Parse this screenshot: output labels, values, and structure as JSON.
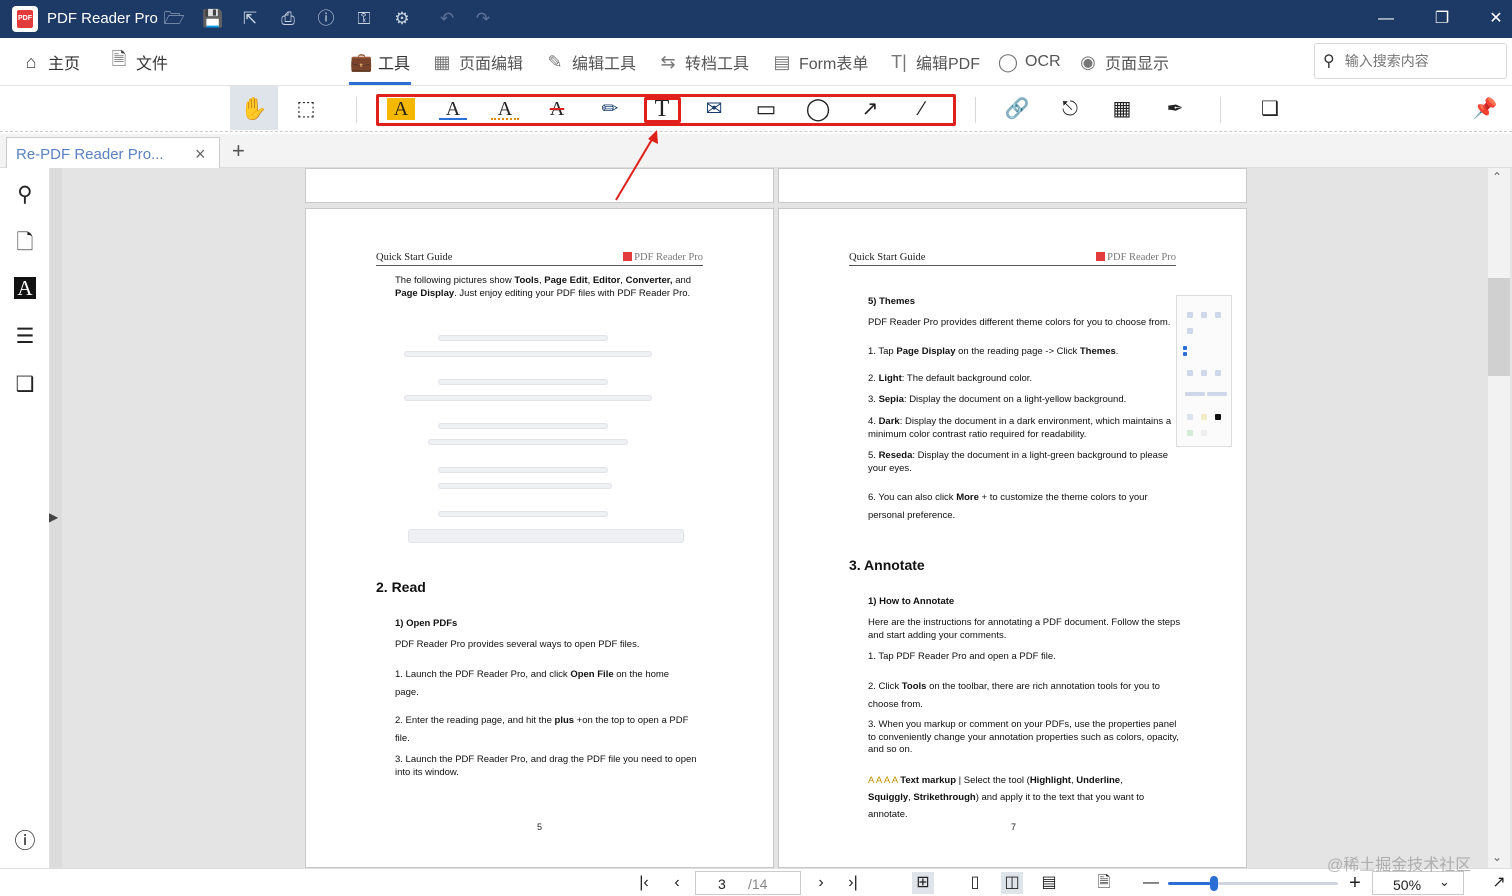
{
  "titlebar": {
    "app_title": "PDF Reader Pro",
    "logo_text": "PDF",
    "icons": [
      "open-folder-icon",
      "save-icon",
      "share-icon",
      "print-icon",
      "help-icon",
      "key-icon",
      "settings-icon",
      "undo-icon",
      "redo-icon"
    ],
    "window_buttons": [
      "minimize-icon",
      "restore-icon",
      "close-icon"
    ]
  },
  "menubar": {
    "home": "主页",
    "file": "文件",
    "tabs": [
      {
        "label": "工具",
        "icon": "toolbox-icon",
        "active": true
      },
      {
        "label": "页面编辑",
        "icon": "page-grid-icon"
      },
      {
        "label": "编辑工具",
        "icon": "edit-icon"
      },
      {
        "label": "转档工具",
        "icon": "convert-icon"
      },
      {
        "label": "Form表单",
        "icon": "form-icon"
      },
      {
        "label": "编辑PDF",
        "icon": "text-edit-icon"
      },
      {
        "label": "OCR",
        "icon": "ocr-icon"
      },
      {
        "label": "页面显示",
        "icon": "eye-icon"
      }
    ],
    "search_placeholder": "输入搜索内容"
  },
  "toolbar": {
    "tools": [
      "hand-icon",
      "area-select-icon",
      "highlight-icon",
      "underline-icon",
      "squiggly-icon",
      "strikethrough-icon",
      "freehand-icon",
      "text-box-icon",
      "note-icon",
      "rectangle-icon",
      "circle-icon",
      "arrow-icon",
      "line-icon",
      "link-icon",
      "stamp-icon",
      "image-icon",
      "signature-icon",
      "bookmark-icon",
      "pin-icon"
    ],
    "accent": "#e0201a"
  },
  "tab": {
    "label": "Re-PDF Reader Pro...",
    "close": "×",
    "add": "+"
  },
  "sidebar": [
    "search-icon",
    "thumbnail-icon",
    "annotation-list-icon",
    "outline-icon",
    "bookmark-icon",
    "info-icon"
  ],
  "page_left": {
    "header_left": "Quick Start Guide",
    "header_right": "PDF Reader Pro",
    "intro_1": "The following pictures show ",
    "intro_b1": "Tools",
    "intro_2": ", ",
    "intro_b2": "Page Edit",
    "intro_3": ", ",
    "intro_b3": "Editor",
    "intro_4": ", ",
    "intro_b4": "Converter,",
    "intro_5": " and",
    "intro_b5": "Page Display",
    "intro_6": ". Just enjoy editing your PDF files with PDF Reader Pro.",
    "section_read": "2.  Read",
    "open_pdfs": "1)  Open PDFs",
    "open_desc": "PDF Reader Pro provides several ways to open PDF files.",
    "step1a": "1.  Launch the PDF Reader Pro, and click ",
    "step1b": "Open File",
    "step1c": "  on the home",
    "step1d": "page.",
    "step2a": "2.  Enter the reading page, and hit the ",
    "step2b": "plus",
    "step2c": "  +on the top to open a PDF",
    "step2d": "file.",
    "step3a": "3.  Launch the PDF Reader Pro, and drag the PDF file you need to open",
    "step3b": "into its window.",
    "page_number": "5"
  },
  "page_right": {
    "header_left": "Quick Start Guide",
    "header_right": "PDF Reader Pro",
    "themes_title": "5)  Themes",
    "themes_desc": "PDF Reader Pro provides different theme colors for you to choose from.",
    "t1a": "1.  Tap ",
    "t1b": "Page Display",
    "t1c": "  on the reading page -> Click ",
    "t1d": "Themes",
    "t1e": ".",
    "t2a": "2.  ",
    "t2b": "Light",
    "t2c": ": The default background color.",
    "t3a": "3.  ",
    "t3b": "Sepia",
    "t3c": ": Display the document on a light-yellow background.",
    "t4a": "4.  ",
    "t4b": "Dark",
    "t4c": ": Display the document in a dark environment, which maintains a",
    "t4d": "minimum color contrast ratio required for readability.",
    "t5a": "5.  ",
    "t5b": "Reseda",
    "t5c": ": Display the document in a light-green background to please",
    "t5d": "your eyes.",
    "t6a": "6.  You can also click ",
    "t6b": "More",
    "t6c": "  +   to customize the theme colors to your",
    "t6d": "personal preference.",
    "section_annotate": "3.  Annotate",
    "how_title": "1)  How to Annotate",
    "how_desc1": "Here are the instructions for annotating a PDF document. Follow the steps",
    "how_desc2": "and start adding your comments.",
    "a1": "1.  Tap PDF Reader Pro and open a PDF file.",
    "a2a": "2.  Click ",
    "a2b": "Tools",
    "a2c": "     on the toolbar, there are rich annotation tools for you to",
    "a2d": "choose from.",
    "a3a": "3.  When you markup or comment on your PDFs, use the properties panel",
    "a3b": "to conveniently change your annotation properties such as colors, opacity,",
    "a3c": "and so on.",
    "tm_icons": "A  A  A  A",
    "tm_a": "Text markup",
    "tm_b": " | Select the tool (",
    "tm_c": "Highlight",
    "tm_d": ", ",
    "tm_e": "Underline",
    "tm_f": ",",
    "tm_g": "Squiggly",
    "tm_h": ", ",
    "tm_i": "Strikethrough",
    "tm_j": ") and apply it to the text that you want to",
    "tm_k": "annotate.",
    "page_number": "7"
  },
  "bottombar": {
    "current_page": "3",
    "total_pages": "/14",
    "zoom_value": "50%",
    "zoom_level": 0.27
  },
  "watermark": "@稀土掘金技术社区"
}
